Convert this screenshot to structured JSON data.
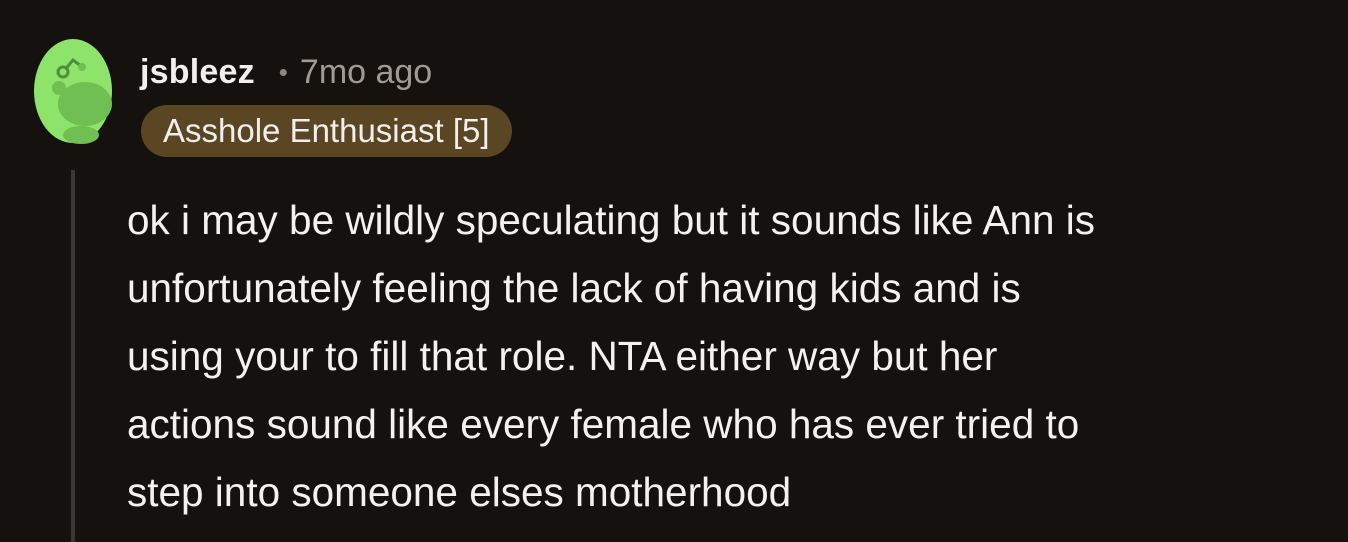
{
  "comment": {
    "username": "jsbleez",
    "separator": "•",
    "timestamp": "7mo ago",
    "flair": "Asshole Enthusiast [5]",
    "body_lines": [
      "ok i may be wildly speculating but it sounds like Ann is",
      "unfortunately feeling the lack of having kids and is",
      "using your to fill that role. NTA either way but her",
      "actions sound like every female who has ever tried to",
      "step into someone elses motherhood"
    ]
  },
  "icons": {
    "avatar": "snoo-avatar-icon"
  },
  "colors": {
    "background": "#15110e",
    "avatar_green": "#8ee36a",
    "flair_background": "#5a4623",
    "text": "#f2f0ee",
    "muted_text": "#a09a94",
    "thread_line": "#3b3734"
  }
}
